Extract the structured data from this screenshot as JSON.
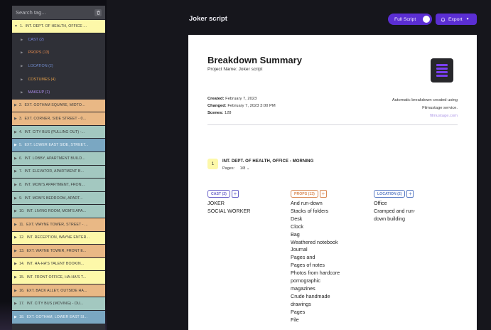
{
  "sidebar": {
    "search_placeholder": "Search tag...",
    "subcategories": [
      {
        "label": "CAST (2)",
        "color": "#7b8be8"
      },
      {
        "label": "PROPS (13)",
        "color": "#e38a4f"
      },
      {
        "label": "LOCATION (2)",
        "color": "#6f89c9"
      },
      {
        "label": "COSTUMES (4)",
        "color": "#e9a24a"
      },
      {
        "label": "MAKEUP (1)",
        "color": "#a98ae8"
      }
    ],
    "scenes": [
      {
        "num": "1.",
        "label": "INT. DEPT. OF HEALTH, OFFICE ...",
        "color": "yellow",
        "expanded": true
      },
      {
        "num": "2.",
        "label": "EXT. GOTHAM SQUARE, MIDTO...",
        "color": "orange"
      },
      {
        "num": "3.",
        "label": "EXT. CORNER, SIDE STREET - 0...",
        "color": "orange"
      },
      {
        "num": "4.",
        "label": "INT. CITY BUS (PULLING OUT) -...",
        "color": "teal"
      },
      {
        "num": "5.",
        "label": "EXT. LOWER EAST SIDE, STREET...",
        "color": "blue"
      },
      {
        "num": "6.",
        "label": "INT. LOBBY, APARTMENT BUILD...",
        "color": "teal"
      },
      {
        "num": "7.",
        "label": "INT. ELEVATOR, APARTMENT B...",
        "color": "teal"
      },
      {
        "num": "8.",
        "label": "INT. MOM'S APARTMENT, FRON...",
        "color": "teal"
      },
      {
        "num": "9.",
        "label": "INT. MOM'S BEDROOM, APART...",
        "color": "teal"
      },
      {
        "num": "10.",
        "label": "INT. LIVING ROOM, MOM'S APA...",
        "color": "teal"
      },
      {
        "num": "11.",
        "label": "EXT. WAYNE TOWER, STREET - ...",
        "color": "orange"
      },
      {
        "num": "12.",
        "label": "INT. RECEPTION, WAYNE ENTER...",
        "color": "yellow"
      },
      {
        "num": "13.",
        "label": "EXT. WAYNE TOWER, FRONT E...",
        "color": "orange"
      },
      {
        "num": "14.",
        "label": "INT. HA-HA'S TALENT BOOKIN...",
        "color": "yellow"
      },
      {
        "num": "15.",
        "label": "INT. FRONT OFFICE, HA-HA'S T...",
        "color": "yellow"
      },
      {
        "num": "16.",
        "label": "EXT. BACK ALLEY, OUTSIDE HA...",
        "color": "orange"
      },
      {
        "num": "17.",
        "label": "INT. CITY BUS (MOVING) - DU...",
        "color": "teal"
      },
      {
        "num": "18.",
        "label": "EXT. GOTHAM, LOWER EAST SI...",
        "color": "blue"
      }
    ]
  },
  "header": {
    "title": "Joker script",
    "full_script_label": "Full Script",
    "export_label": "Export"
  },
  "colors": {
    "accent": "#5b2ed3",
    "scene_yellow": "#fdf8a9",
    "scene_orange": "#e9b885",
    "scene_teal": "#a3c8c0",
    "scene_blue": "#7aa7c2"
  },
  "summary": {
    "title": "Breakdown Summary",
    "project_label": "Project Name:",
    "project_name": "Joker script",
    "created_label": "Created:",
    "created": "February 7, 2023",
    "changed_label": "Changed:",
    "changed": "February 7, 2023 3:00 PM",
    "scenes_label": "Scenes:",
    "scenes": "128",
    "auto_line1": "Automatic breakdown created using",
    "auto_line2": "Filmustage service.",
    "auto_link": "filmustage.com"
  },
  "scene_detail": {
    "number": "1",
    "heading": "INT. DEPT. OF HEALTH, OFFICE - MORNING",
    "pages_label": "Pages:",
    "pages_value": "1/8"
  },
  "categories": [
    {
      "label": "CAST (2)",
      "color": "#6b63c9",
      "items": [
        "JOKER",
        "SOCIAL WORKER"
      ]
    },
    {
      "label": "PROPS (13)",
      "color": "#d98a55",
      "items": [
        "And run-down",
        "Stacks of folders",
        "Desk",
        "Clock",
        "Bag",
        "Weathered notebook",
        "Journal",
        "Pages and",
        "Pages of notes",
        "Photos from hardcore",
        "pornographic",
        "magazines",
        "Crude handmade",
        "drawings",
        "Pages",
        "File"
      ]
    },
    {
      "label": "LOCATION (2)",
      "color": "#5a7cc4",
      "items": [
        "Office",
        "Cramped and run-",
        "down building"
      ]
    }
  ]
}
